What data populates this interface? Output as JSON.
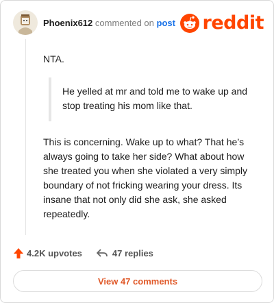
{
  "header": {
    "username": "Phoenix612",
    "action_text": "commented on",
    "post_link": "post",
    "brand_name": "reddit",
    "brand_color": "#ff4500"
  },
  "comment": {
    "opening": "NTA.",
    "quote": "He yelled at mr and told me to wake up and stop treating his mom like that.",
    "body": "This is concerning. Wake up to what? That he’s always going to take her side? What about how she treated you when she violated a very simply boundary of not fricking wearing your dress. Its insane that not only did she ask, she asked repeatedly."
  },
  "footer": {
    "upvotes": "4.2K upvotes",
    "replies": "47 replies",
    "view_button": "View 47 comments",
    "upvote_icon": "upvote-arrow-icon",
    "reply_icon": "reply-arrow-icon"
  }
}
